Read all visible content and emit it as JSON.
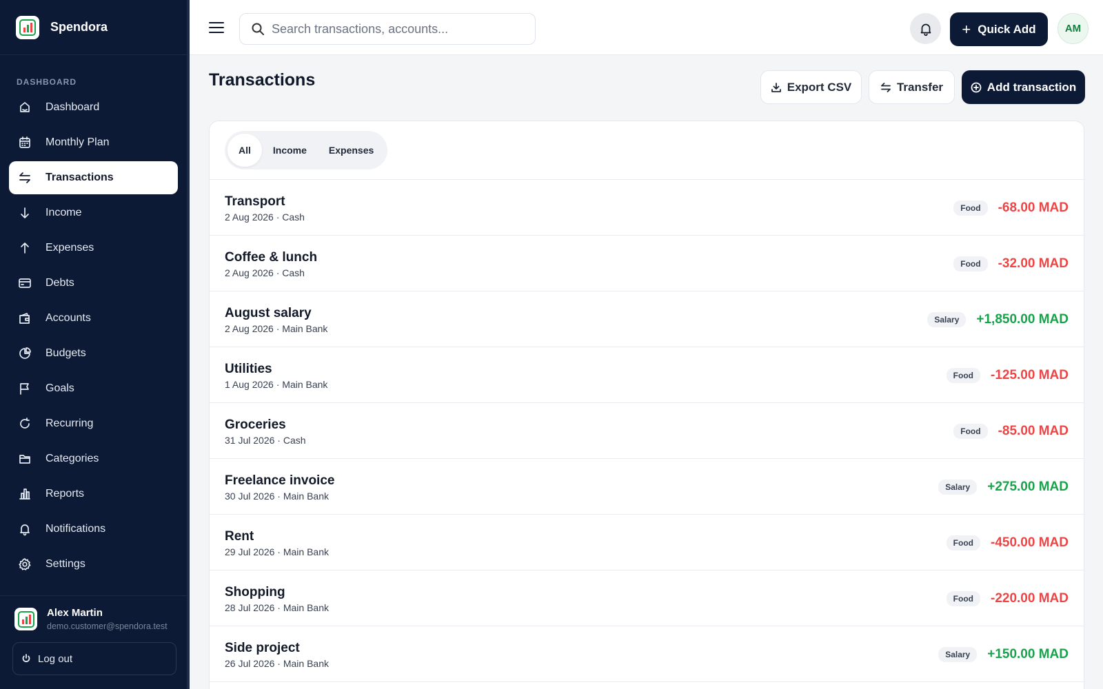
{
  "brand": {
    "name": "Spendora"
  },
  "sidebar": {
    "section_label": "DASHBOARD",
    "items": [
      {
        "label": "Dashboard",
        "icon": "dashboard-icon",
        "active": false
      },
      {
        "label": "Monthly Plan",
        "icon": "calendar-icon",
        "active": false
      },
      {
        "label": "Transactions",
        "icon": "arrows-exchange-icon",
        "active": true
      },
      {
        "label": "Income",
        "icon": "arrow-down-icon",
        "active": false
      },
      {
        "label": "Expenses",
        "icon": "arrow-up-icon",
        "active": false
      },
      {
        "label": "Debts",
        "icon": "credit-card-icon",
        "active": false
      },
      {
        "label": "Accounts",
        "icon": "wallet-icon",
        "active": false
      },
      {
        "label": "Budgets",
        "icon": "pie-chart-icon",
        "active": false
      },
      {
        "label": "Goals",
        "icon": "flag-icon",
        "active": false
      },
      {
        "label": "Recurring",
        "icon": "refresh-icon",
        "active": false
      },
      {
        "label": "Categories",
        "icon": "folder-icon",
        "active": false
      },
      {
        "label": "Reports",
        "icon": "bar-chart-icon",
        "active": false
      },
      {
        "label": "Notifications",
        "icon": "bell-icon",
        "active": false
      },
      {
        "label": "Settings",
        "icon": "gear-icon",
        "active": false
      }
    ]
  },
  "user": {
    "name": "Alex Martin",
    "email": "demo.customer@spendora.test",
    "logout_label": "Log out"
  },
  "topbar": {
    "search_placeholder": "Search transactions, accounts...",
    "quick_add_label": "Quick Add",
    "avatar_initials": "AM"
  },
  "page": {
    "title": "Transactions",
    "export_label": "Export CSV",
    "transfer_label": "Transfer",
    "add_label": "Add transaction"
  },
  "filters": {
    "tabs": [
      {
        "label": "All",
        "active": true
      },
      {
        "label": "Income",
        "active": false
      },
      {
        "label": "Expenses",
        "active": false
      }
    ]
  },
  "transactions": [
    {
      "title": "Transport",
      "meta": "2 Aug 2026 · Cash",
      "category": "Food",
      "amount": "-68.00 MAD",
      "type": "expense"
    },
    {
      "title": "Coffee & lunch",
      "meta": "2 Aug 2026 · Cash",
      "category": "Food",
      "amount": "-32.00 MAD",
      "type": "expense"
    },
    {
      "title": "August salary",
      "meta": "2 Aug 2026 · Main Bank",
      "category": "Salary",
      "amount": "+1,850.00 MAD",
      "type": "income"
    },
    {
      "title": "Utilities",
      "meta": "1 Aug 2026 · Main Bank",
      "category": "Food",
      "amount": "-125.00 MAD",
      "type": "expense"
    },
    {
      "title": "Groceries",
      "meta": "31 Jul 2026 · Cash",
      "category": "Food",
      "amount": "-85.00 MAD",
      "type": "expense"
    },
    {
      "title": "Freelance invoice",
      "meta": "30 Jul 2026 · Main Bank",
      "category": "Salary",
      "amount": "+275.00 MAD",
      "type": "income"
    },
    {
      "title": "Rent",
      "meta": "29 Jul 2026 · Main Bank",
      "category": "Food",
      "amount": "-450.00 MAD",
      "type": "expense"
    },
    {
      "title": "Shopping",
      "meta": "28 Jul 2026 · Main Bank",
      "category": "Food",
      "amount": "-220.00 MAD",
      "type": "expense"
    },
    {
      "title": "Side project",
      "meta": "26 Jul 2026 · Main Bank",
      "category": "Salary",
      "amount": "+150.00 MAD",
      "type": "income"
    }
  ],
  "colors": {
    "sidebar_bg": "#0c1a35",
    "expense": "#ef4444",
    "income": "#16a34a",
    "primary_button": "#0c1a35"
  }
}
